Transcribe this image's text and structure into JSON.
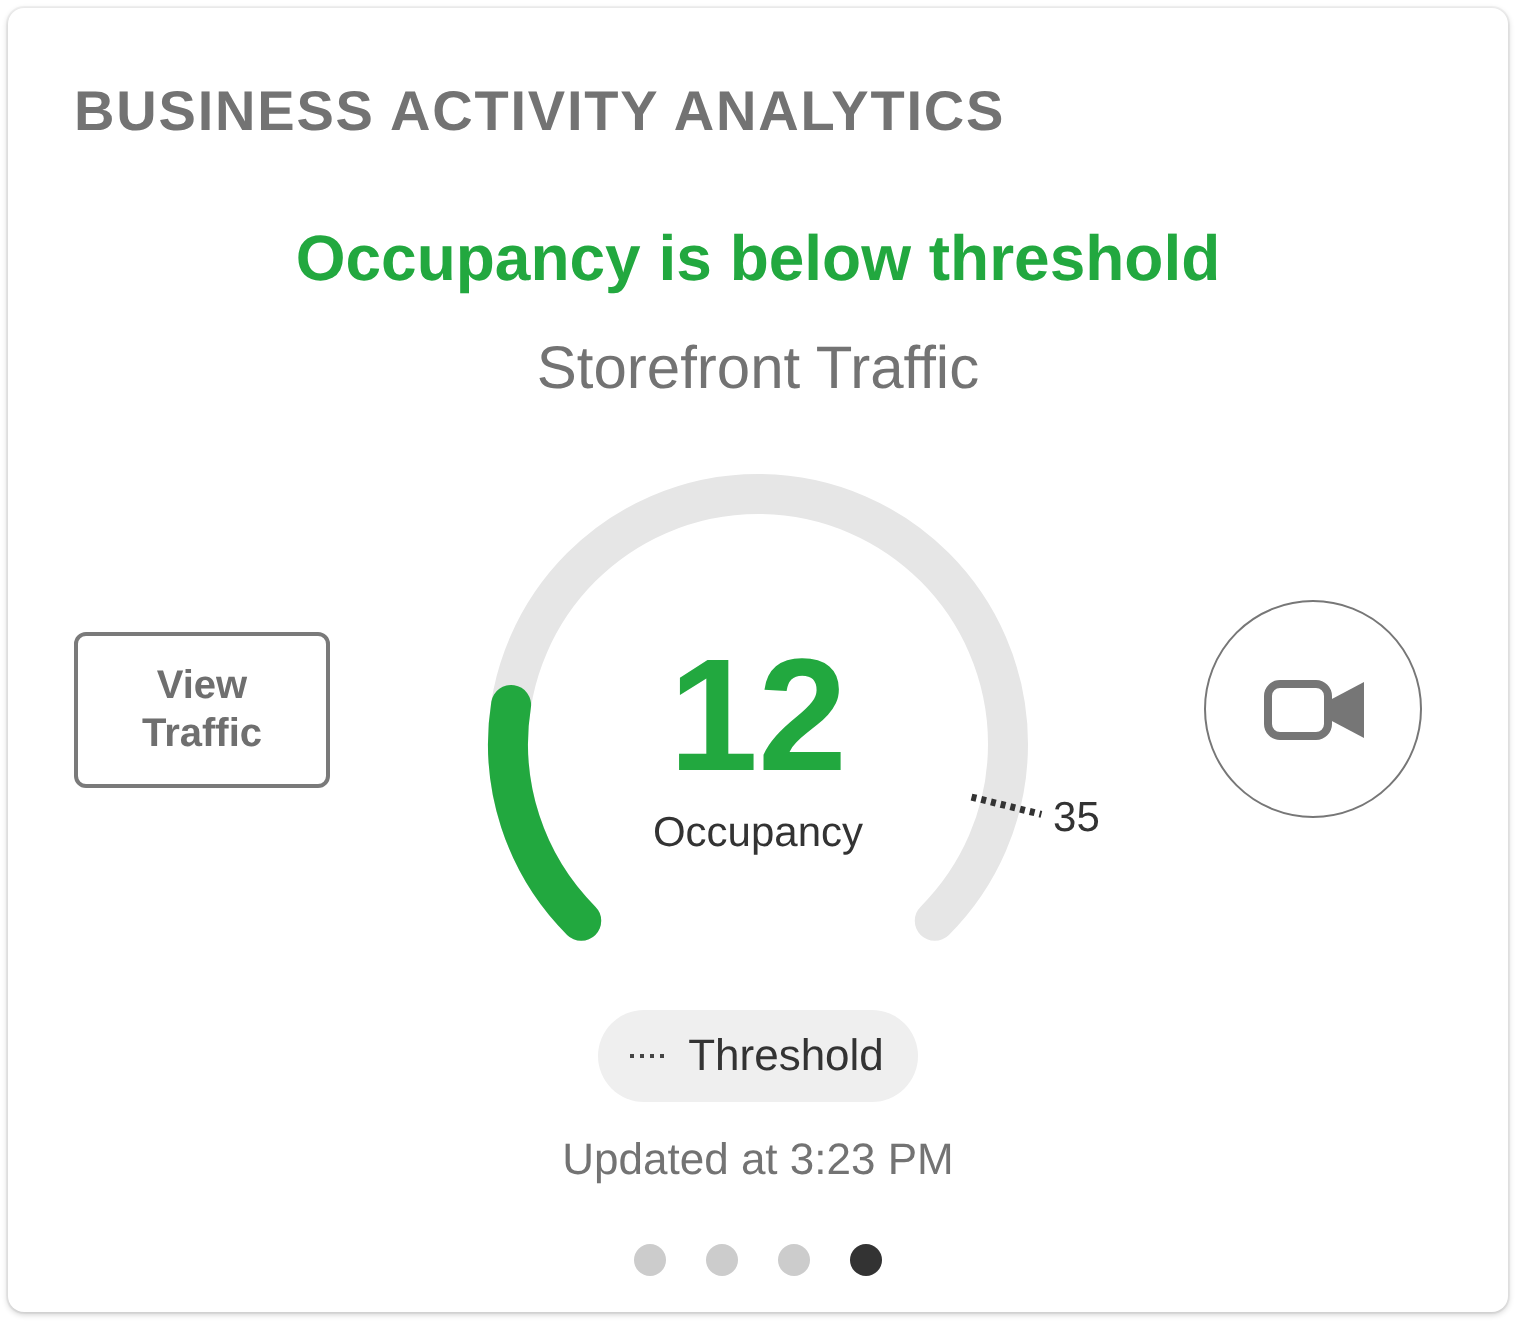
{
  "title": "BUSINESS ACTIVITY ANALYTICS",
  "status_message": "Occupancy is below threshold",
  "subtitle": "Storefront Traffic",
  "view_button": {
    "label": "View Traffic"
  },
  "gauge": {
    "value": "12",
    "label": "Occupancy",
    "level": 0.2,
    "threshold": {
      "label": "35",
      "level": 0.885
    }
  },
  "legend": {
    "label": "Threshold"
  },
  "updated": "Updated at 3:23 PM",
  "pages": [
    {
      "selected": false
    },
    {
      "selected": false
    },
    {
      "selected": false
    },
    {
      "selected": true
    }
  ]
}
